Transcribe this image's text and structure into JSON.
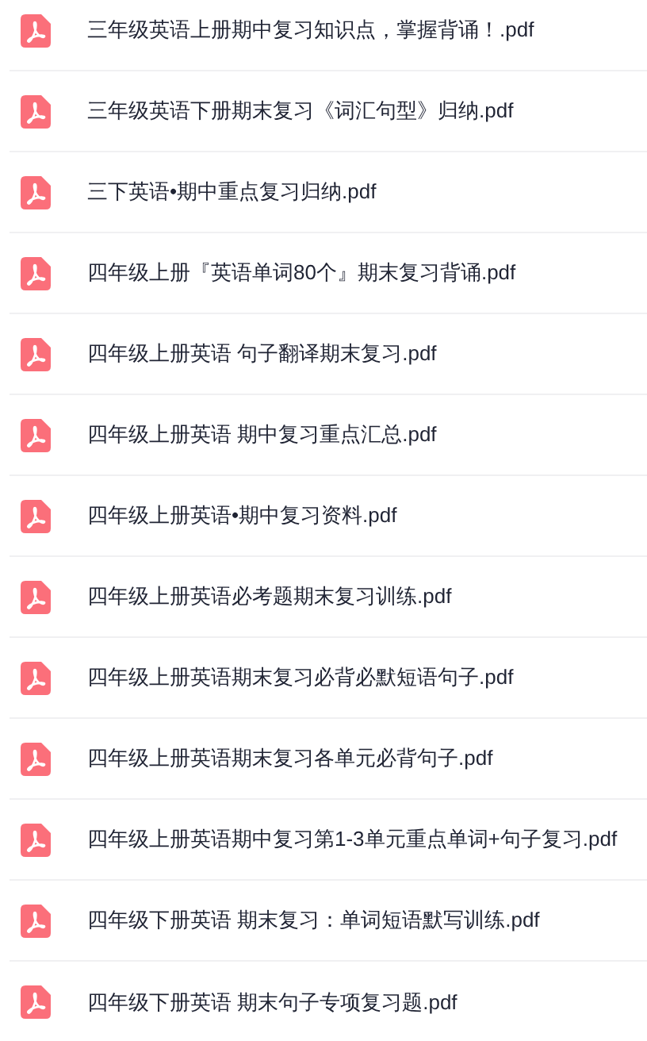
{
  "files": [
    {
      "name": "三年级英语上册期中复习知识点，掌握背诵！.pdf"
    },
    {
      "name": "三年级英语下册期末复习《词汇句型》归纳.pdf"
    },
    {
      "name": "三下英语•期中重点复习归纳.pdf"
    },
    {
      "name": "四年级上册『英语单词80个』期末复习背诵.pdf"
    },
    {
      "name": "四年级上册英语 句子翻译期末复习.pdf"
    },
    {
      "name": "四年级上册英语 期中复习重点汇总.pdf"
    },
    {
      "name": "四年级上册英语•期中复习资料.pdf"
    },
    {
      "name": "四年级上册英语必考题期末复习训练.pdf"
    },
    {
      "name": "四年级上册英语期末复习必背必默短语句子.pdf"
    },
    {
      "name": "四年级上册英语期末复习各单元必背句子.pdf"
    },
    {
      "name": "四年级上册英语期中复习第1-3单元重点单词+句子复习.pdf"
    },
    {
      "name": "四年级下册英语 期末复习：单词短语默写训练.pdf"
    },
    {
      "name": "四年级下册英语 期末句子专项复习题.pdf"
    }
  ]
}
